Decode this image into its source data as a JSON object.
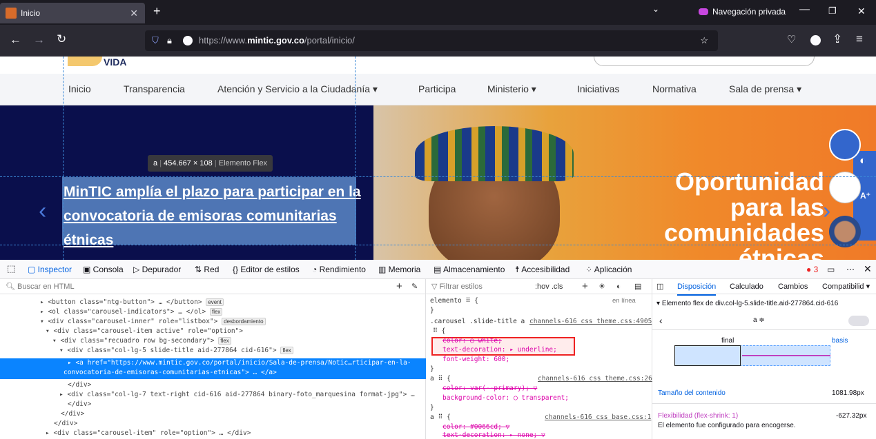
{
  "browser": {
    "tab_title": "Inicio",
    "private_label": "Navegación privada",
    "url_prefix": "https://www.",
    "url_domain": "mintic.gov.co",
    "url_path": "/portal/inicio/"
  },
  "site": {
    "logo_text": "VIDA",
    "menu": [
      "Inicio",
      "Transparencia",
      "Atención y Servicio a la Ciudadanía ▾",
      "Participa",
      "Ministerio ▾",
      "Iniciativas",
      "Normativa",
      "Sala de prensa ▾"
    ],
    "hero_title": "MinTIC amplía el plazo para participar en la convocatoria de emisoras comunitarias étnicas",
    "hero_banner": [
      "Oportunidad",
      "para las",
      "comunidades",
      "étnicas"
    ],
    "tooltip_tag": "a",
    "tooltip_size": "454.667 × 108",
    "tooltip_kind": "Elemento Flex"
  },
  "devtools": {
    "tabs": [
      "Inspector",
      "Consola",
      "Depurador",
      "Red",
      "Editor de estilos",
      "Rendimiento",
      "Memoria",
      "Almacenamiento",
      "Accesibilidad",
      "Aplicación"
    ],
    "error_count": "3",
    "html_search_placeholder": "Buscar en HTML",
    "html_lines": [
      {
        "text": "<button class=\"ntg-button\"> … </button>",
        "badge": "event"
      },
      {
        "text": "<ol class=\"carousel-indicators\"> … </ol>",
        "badge": "flex"
      },
      {
        "text": "<div class=\"carousel-inner\" role=\"listbox\">",
        "badge": "desbordamiento"
      },
      {
        "text": "<div class=\"carousel-item active\" role=\"option\">",
        "badge": ""
      },
      {
        "text": "<div class=\"recuadro row bg-secondary\">",
        "badge": "flex"
      },
      {
        "text": "<div class=\"col-lg-5 slide-title aid-277864 cid-616\">",
        "badge": "flex"
      },
      {
        "text": "<a href=\"https://www.mintic.gov.co/portal/inicio/Sala-de-prensa/Notic…rticipar-en-la-",
        "badge": ""
      },
      {
        "text": "convocatoria-de-emisoras-comunitarias-etnicas\"> … </a>",
        "badge": ""
      },
      {
        "text": "</div>",
        "badge": ""
      },
      {
        "text": "<div class=\"col-lg-7 text-right cid-616 aid-277864 binary-foto_marquesina format-jpg\"> …",
        "badge": ""
      },
      {
        "text": "</div>",
        "badge": ""
      },
      {
        "text": "</div>",
        "badge": ""
      },
      {
        "text": "</div>",
        "badge": ""
      },
      {
        "text": "<div class=\"carousel-item\" role=\"option\"> … </div>",
        "badge": ""
      }
    ],
    "rules_filter_placeholder": "Filtrar estilos",
    "rules_toolbar": ":hov  .cls",
    "rules": [
      {
        "sel": "elemento ⠿ {",
        "src": "en línea"
      },
      {
        "sel": "}",
        "src": ""
      },
      {
        "sel": ".carousel .slide-title a",
        "src": "channels-616 css theme.css:4905"
      },
      {
        "sel": "⠿ {",
        "src": ""
      },
      {
        "sel": "color: ◯ white;",
        "src": ""
      },
      {
        "sel": "text-decoration: ▸ underline;",
        "src": ""
      },
      {
        "sel": "font-weight: 600;",
        "src": ""
      },
      {
        "sel": "}",
        "src": ""
      },
      {
        "sel": "a ⠿ {",
        "src": "channels-616 css theme.css:26"
      },
      {
        "sel": "color: var(--primary); ▽",
        "src": ""
      },
      {
        "sel": "background-color: ◯ transparent;",
        "src": ""
      },
      {
        "sel": "}",
        "src": ""
      },
      {
        "sel": "a ⠿ {",
        "src": "channels-616 css base.css:1"
      },
      {
        "sel": "color: #0066cd; ▽",
        "src": ""
      },
      {
        "sel": "text-decoration: ▸ none; ▽",
        "src": ""
      }
    ],
    "layout_tabs": [
      "Disposición",
      "Calculado",
      "Cambios",
      "Compatibilid ▾"
    ],
    "flex_header": "Elemento flex de div.col-lg-5.slide-title.aid-277864.cid-616",
    "flex_selector": "a ≑",
    "flex_final": "final",
    "flex_basis": "basis",
    "content_size_label": "Tamaño del contenido",
    "content_size_value": "1081.98px",
    "flex_shrink_label": "Flexibilidad  (flex-shrink: 1)",
    "flex_shrink_value": "-627.32px",
    "flex_shrink_note": "El elemento fue configurado para encogerse."
  }
}
